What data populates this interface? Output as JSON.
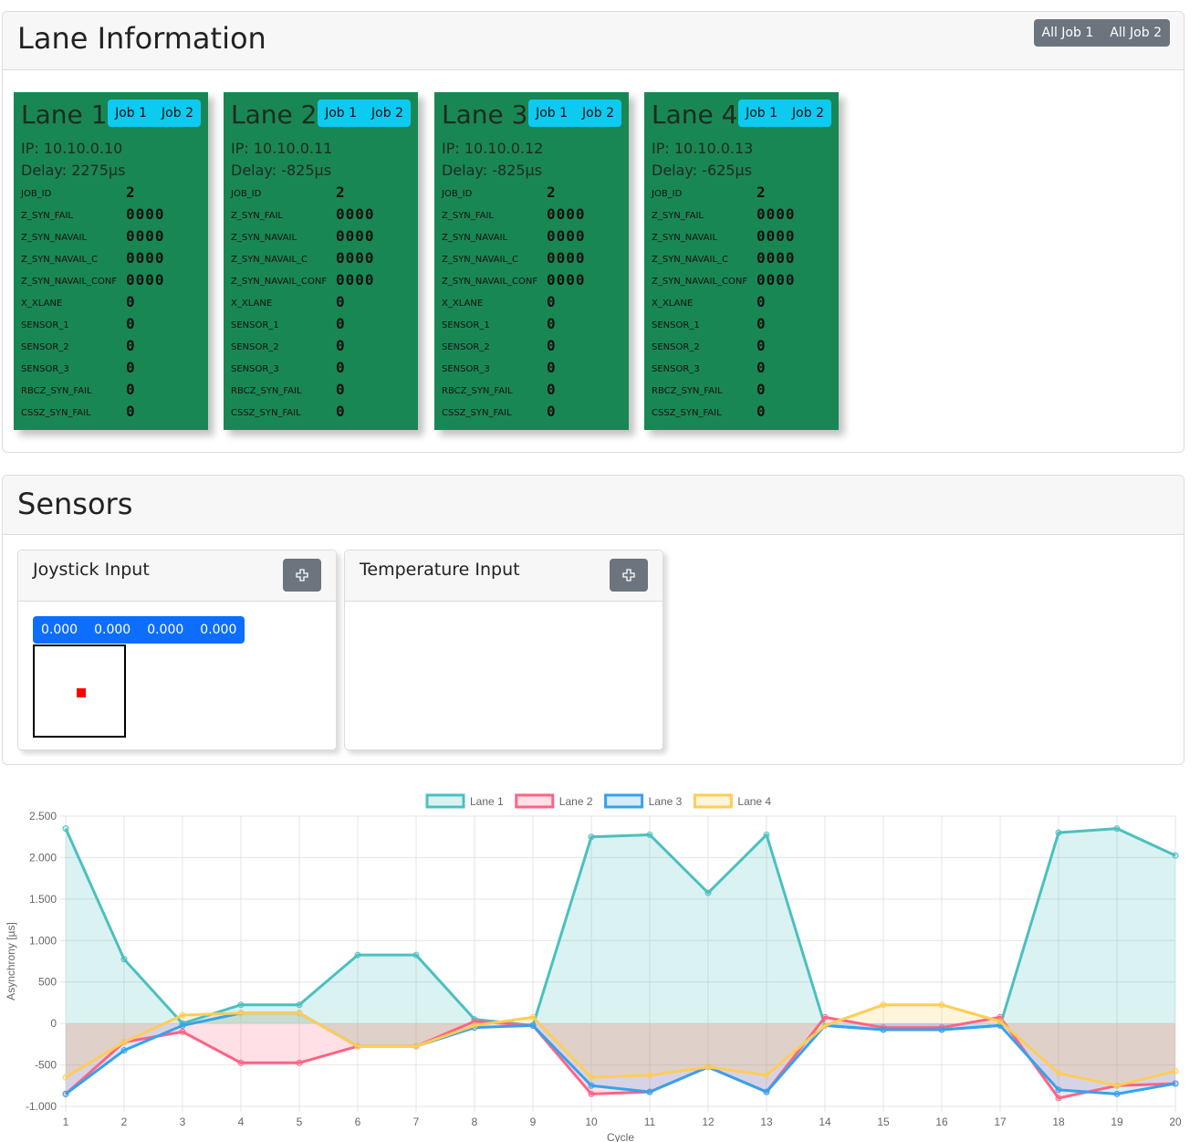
{
  "lane_info": {
    "title": "Lane Information",
    "all_job1": "All Job 1",
    "all_job2": "All Job 2",
    "lanes": [
      {
        "title": "Lane 1",
        "job1": "Job 1",
        "job2": "Job 2",
        "ip": "IP: 10.10.0.10",
        "delay": "Delay:  2275µs"
      },
      {
        "title": "Lane 2",
        "job1": "Job 1",
        "job2": "Job 2",
        "ip": "IP: 10.10.0.11",
        "delay": "Delay:  -825µs"
      },
      {
        "title": "Lane 3",
        "job1": "Job 1",
        "job2": "Job 2",
        "ip": "IP: 10.10.0.12",
        "delay": "Delay:  -825µs"
      },
      {
        "title": "Lane 4",
        "job1": "Job 1",
        "job2": "Job 2",
        "ip": "IP: 10.10.0.13",
        "delay": "Delay:  -625µs"
      }
    ],
    "registers": [
      "JOB_ID",
      "Z_SYN_FAIL",
      "Z_SYN_NAVAIL",
      "Z_SYN_NAVAIL_C",
      "Z_SYN_NAVAIL_CONF",
      "X_XLANE",
      "SENSOR_1",
      "SENSOR_2",
      "SENSOR_3",
      "RBCZ_SYN_FAIL",
      "CSSZ_SYN_FAIL"
    ],
    "register_values": [
      "2",
      "0000",
      "0000",
      "0000",
      "0000",
      "0",
      "0",
      "0",
      "0",
      "0",
      "0"
    ]
  },
  "sensors": {
    "title": "Sensors",
    "joystick_title": "Joystick Input",
    "temperature_title": "Temperature Input",
    "joystick_values": [
      "0.000",
      "0.000",
      "0.000",
      "0.000"
    ],
    "settings_icon": "gear-icon"
  },
  "chart_data": {
    "type": "line",
    "xlabel": "Cycle",
    "ylabel": "Asynchrony [µs]",
    "x": [
      1,
      2,
      3,
      4,
      5,
      6,
      7,
      8,
      9,
      10,
      11,
      12,
      13,
      14,
      15,
      16,
      17,
      18,
      19,
      20
    ],
    "ylim": [
      -1000,
      2500
    ],
    "yticks": [
      "2.500",
      "2.000",
      "1.500",
      "1.000",
      "500",
      "0",
      "-500",
      "-1.000"
    ],
    "ytick_values": [
      2500,
      2000,
      1500,
      1000,
      500,
      0,
      -500,
      -1000
    ],
    "grid": true,
    "legend_position": "top",
    "series": [
      {
        "name": "Lane 1",
        "color": "#4bc0c0",
        "fill": "rgba(75,192,192,0.2)",
        "values": [
          2350,
          775,
          0,
          225,
          225,
          825,
          825,
          50,
          -25,
          2250,
          2275,
          1575,
          2275,
          -25,
          -75,
          -75,
          -25,
          2300,
          2350,
          2025
        ]
      },
      {
        "name": "Lane 2",
        "color": "#ff6384",
        "fill": "rgba(255,99,132,0.2)",
        "values": [
          -850,
          -225,
          -100,
          -475,
          -475,
          -275,
          -275,
          25,
          -25,
          -850,
          -825,
          -525,
          -825,
          75,
          -50,
          -50,
          75,
          -900,
          -750,
          -725
        ]
      },
      {
        "name": "Lane 3",
        "color": "#36a2eb",
        "fill": "rgba(54,162,235,0.2)",
        "values": [
          -850,
          -325,
          -25,
          125,
          125,
          -275,
          -275,
          -50,
          -25,
          -750,
          -825,
          -525,
          -825,
          -25,
          -75,
          -75,
          -25,
          -800,
          -850,
          -725
        ]
      },
      {
        "name": "Lane 4",
        "color": "#ffcd56",
        "fill": "rgba(255,205,86,0.2)",
        "values": [
          -650,
          -225,
          100,
          125,
          125,
          -275,
          -275,
          -25,
          75,
          -650,
          -625,
          -525,
          -625,
          -25,
          225,
          225,
          25,
          -600,
          -750,
          -575
        ]
      }
    ]
  }
}
